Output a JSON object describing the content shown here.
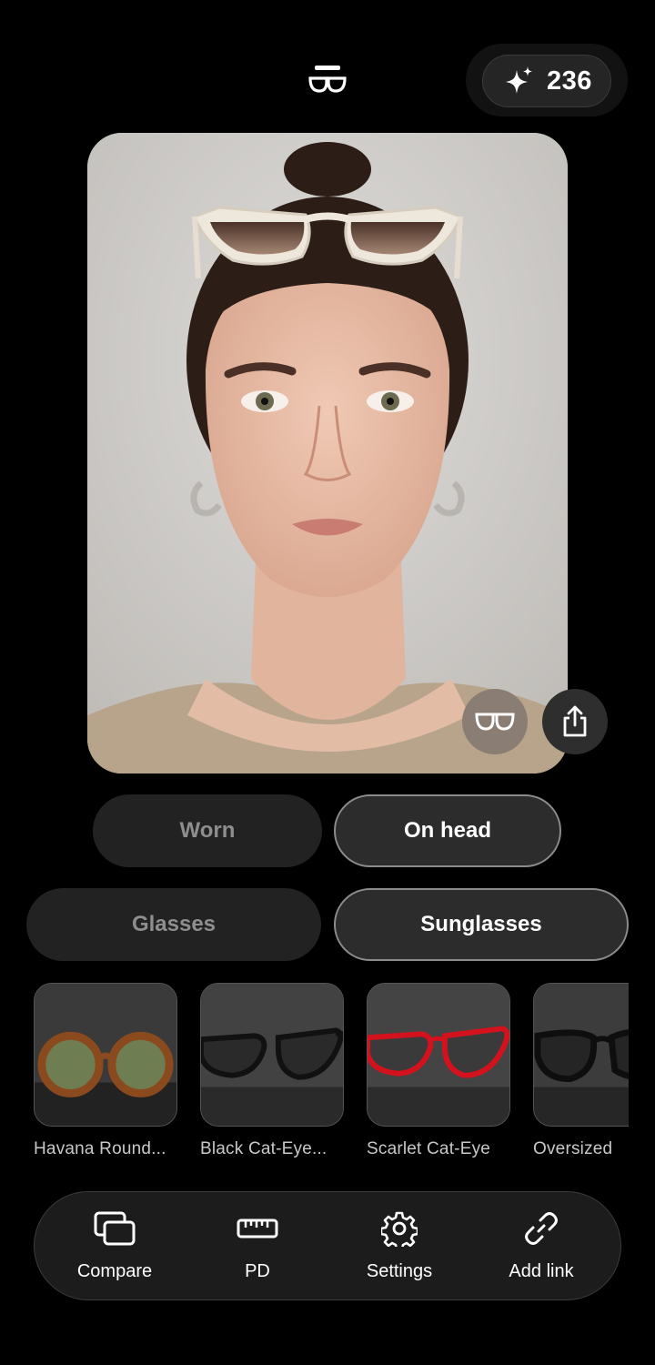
{
  "header": {
    "logo_icon": "glasses-logo-icon",
    "credits": {
      "icon": "sparkle-icon",
      "value": "236"
    }
  },
  "preview": {
    "glasses_toggle_icon": "glasses-icon",
    "share_icon": "share-icon"
  },
  "wear_mode": {
    "options": [
      {
        "label": "Worn",
        "selected": false
      },
      {
        "label": "On head",
        "selected": true
      }
    ]
  },
  "category": {
    "options": [
      {
        "label": "Glasses",
        "selected": false
      },
      {
        "label": "Sunglasses",
        "selected": true
      }
    ]
  },
  "products": [
    {
      "name": "Havana Round...",
      "frame_color": "#8a4a1e",
      "lens_color": "#6f7d52"
    },
    {
      "name": "Black Cat-Eye...",
      "frame_color": "#111111",
      "lens_color": "#2a2a2a"
    },
    {
      "name": "Scarlet Cat-Eye",
      "frame_color": "#d4121e",
      "lens_color": "#3a3a3a"
    },
    {
      "name": "Oversized",
      "frame_color": "#0e0e0e",
      "lens_color": "#252525"
    }
  ],
  "toolbar": {
    "items": [
      {
        "label": "Compare",
        "icon": "compare-icon"
      },
      {
        "label": "PD",
        "icon": "ruler-icon"
      },
      {
        "label": "Settings",
        "icon": "gear-icon"
      },
      {
        "label": "Add link",
        "icon": "link-icon"
      }
    ]
  },
  "colors": {
    "background": "#000000",
    "pill_inactive": "#222222",
    "pill_active_border": "#8c8c8c",
    "toggle_button": "#8a7e74"
  }
}
